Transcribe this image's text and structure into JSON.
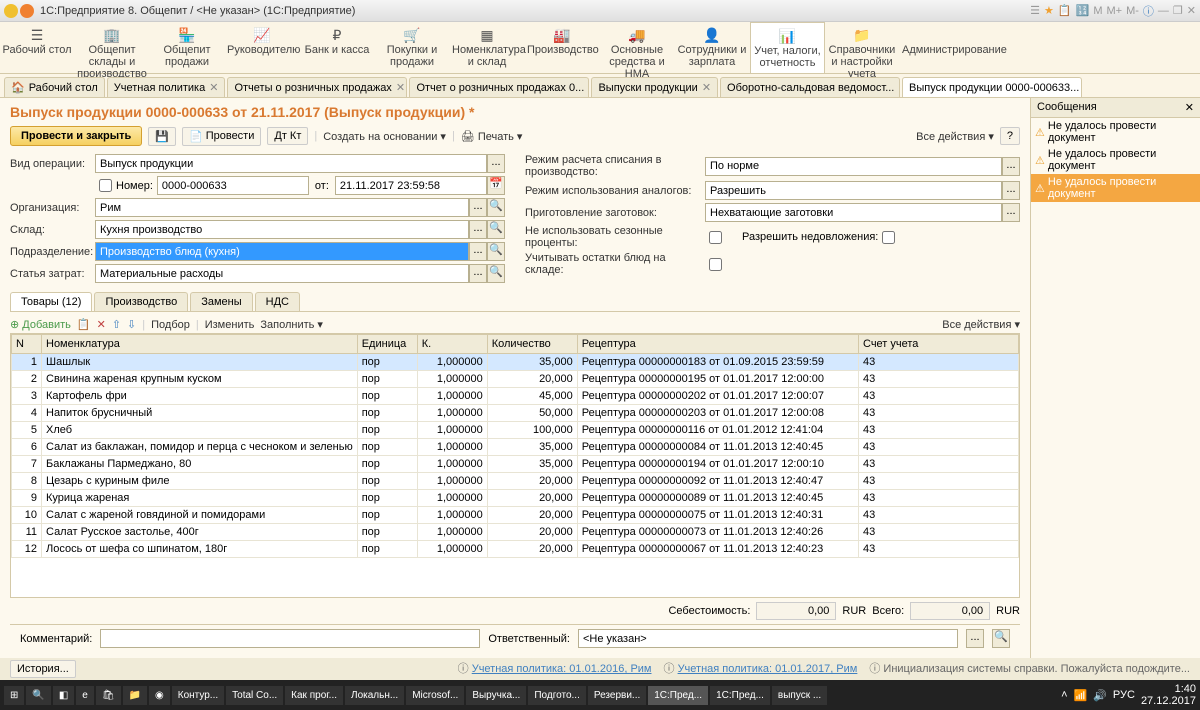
{
  "window_title": "1С:Предприятие 8. Общепит / <Не указан>  (1С:Предприятие)",
  "main_menu": [
    {
      "label": "Рабочий стол"
    },
    {
      "label": "Общепит склады и производство"
    },
    {
      "label": "Общепит продажи"
    },
    {
      "label": "Руководителю"
    },
    {
      "label": "Банк и касса"
    },
    {
      "label": "Покупки и продажи"
    },
    {
      "label": "Номенклатура и склад"
    },
    {
      "label": "Производство"
    },
    {
      "label": "Основные средства и НМА"
    },
    {
      "label": "Сотрудники и зарплата"
    },
    {
      "label": "Учет, налоги, отчетность"
    },
    {
      "label": "Справочники и настройки учета"
    },
    {
      "label": "Администрирование"
    }
  ],
  "tabs": [
    {
      "label": "Рабочий стол"
    },
    {
      "label": "Учетная политика"
    },
    {
      "label": "Отчеты о розничных продажах"
    },
    {
      "label": "Отчет о розничных продажах 0..."
    },
    {
      "label": "Выпуски продукции"
    },
    {
      "label": "Оборотно-сальдовая ведомост..."
    },
    {
      "label": "Выпуск продукции 0000-000633...",
      "active": true
    }
  ],
  "side": {
    "title": "Сообщения",
    "msgs": [
      "Не удалось провести документ",
      "Не удалось провести документ",
      "Не удалось провести документ"
    ]
  },
  "doc_title": "Выпуск продукции 0000-000633 от 21.11.2017 (Выпуск продукции) *",
  "actions": {
    "main": "Провести и закрыть",
    "post": "Провести",
    "create": "Создать на основании",
    "print": "Печать",
    "all": "Все действия"
  },
  "form": {
    "vid_label": "Вид операции:",
    "vid": "Выпуск продукции",
    "num_label": "Номер:",
    "num": "0000-000633",
    "ot": "от:",
    "date": "21.11.2017 23:59:58",
    "org_label": "Организация:",
    "org": "Рим",
    "sklad_label": "Склад:",
    "sklad": "Кухня производство",
    "podr_label": "Подразделение:",
    "podr": "Производство блюд (кухня)",
    "stat_label": "Статья затрат:",
    "stat": "Материальные расходы",
    "rezh1_label": "Режим расчета списания в производство:",
    "rezh1": "По норме",
    "rezh2_label": "Режим использования аналогов:",
    "rezh2": "Разрешить",
    "prig_label": "Приготовление заготовок:",
    "prig": "Нехватающие заготовки",
    "sez_label": "Не использовать сезонные проценты:",
    "nedo_label": "Разрешить недовложения:",
    "ost_label": "Учитывать остатки блюд на складе:"
  },
  "inner_tabs": [
    "Товары (12)",
    "Производство",
    "Замены",
    "НДС"
  ],
  "grid_tb": {
    "add": "Добавить",
    "podbor": "Подбор",
    "izm": "Изменить",
    "fill": "Заполнить",
    "all": "Все действия"
  },
  "cols": {
    "n": "N",
    "nom": "Номенклатура",
    "ed": "Единица",
    "k": "К.",
    "qty": "Количество",
    "rec": "Рецептура",
    "acc": "Счет учета"
  },
  "rows": [
    {
      "n": 1,
      "nom": "Шашлык",
      "ed": "пор",
      "k": "1,000000",
      "qty": "35,000",
      "rec": "Рецептура 00000000183 от 01.09.2015 23:59:59",
      "acc": "43"
    },
    {
      "n": 2,
      "nom": "Свинина жареная крупным куском",
      "ed": "пор",
      "k": "1,000000",
      "qty": "20,000",
      "rec": "Рецептура 00000000195 от 01.01.2017 12:00:00",
      "acc": "43"
    },
    {
      "n": 3,
      "nom": "Картофель фри",
      "ed": "пор",
      "k": "1,000000",
      "qty": "45,000",
      "rec": "Рецептура 00000000202 от 01.01.2017 12:00:07",
      "acc": "43"
    },
    {
      "n": 4,
      "nom": "Напиток брусничный",
      "ed": "пор",
      "k": "1,000000",
      "qty": "50,000",
      "rec": "Рецептура 00000000203 от 01.01.2017 12:00:08",
      "acc": "43"
    },
    {
      "n": 5,
      "nom": "Хлеб",
      "ed": "пор",
      "k": "1,000000",
      "qty": "100,000",
      "rec": "Рецептура 00000000116 от 01.01.2012 12:41:04",
      "acc": "43"
    },
    {
      "n": 6,
      "nom": "Салат из баклажан, помидор и перца с чесноком и зеленью",
      "ed": "пор",
      "k": "1,000000",
      "qty": "35,000",
      "rec": "Рецептура 00000000084 от 11.01.2013 12:40:45",
      "acc": "43"
    },
    {
      "n": 7,
      "nom": "Баклажаны Пармеджано, 80",
      "ed": "пор",
      "k": "1,000000",
      "qty": "35,000",
      "rec": "Рецептура 00000000194 от 01.01.2017 12:00:10",
      "acc": "43"
    },
    {
      "n": 8,
      "nom": "Цезарь с куриным филе",
      "ed": "пор",
      "k": "1,000000",
      "qty": "20,000",
      "rec": "Рецептура 00000000092 от 11.01.2013 12:40:47",
      "acc": "43"
    },
    {
      "n": 9,
      "nom": "Курица жареная",
      "ed": "пор",
      "k": "1,000000",
      "qty": "20,000",
      "rec": "Рецептура 00000000089 от 11.01.2013 12:40:45",
      "acc": "43"
    },
    {
      "n": 10,
      "nom": "Салат с жареной говядиной и помидорами",
      "ed": "пор",
      "k": "1,000000",
      "qty": "20,000",
      "rec": "Рецептура 00000000075 от 11.01.2013 12:40:31",
      "acc": "43"
    },
    {
      "n": 11,
      "nom": "Салат Русское застолье, 400г",
      "ed": "пор",
      "k": "1,000000",
      "qty": "20,000",
      "rec": "Рецептура 00000000073 от 11.01.2013 12:40:26",
      "acc": "43"
    },
    {
      "n": 12,
      "nom": "Лосось от шефа со шпинатом, 180г",
      "ed": "пор",
      "k": "1,000000",
      "qty": "20,000",
      "rec": "Рецептура 00000000067 от 11.01.2013 12:40:23",
      "acc": "43"
    }
  ],
  "footer": {
    "seb": "Себестоимость:",
    "seb_v": "0,00",
    "cur": "RUR",
    "vsego": "Всего:",
    "vsego_v": "0,00"
  },
  "bottom": {
    "komm": "Комментарий:",
    "otv": "Ответственный:",
    "otv_v": "<Не указан>",
    "hist": "История..."
  },
  "status": {
    "p1": "Учетная политика: 01.01.2016, Рим",
    "p2": "Учетная политика: 01.01.2017, Рим",
    "init": "Инициализация системы справки. Пожалуйста подождите..."
  },
  "taskbar": [
    "Контур...",
    "Total Co...",
    "Как прог...",
    "Локальн...",
    "Microsof...",
    "Выручка...",
    "Подгото...",
    "Резерви...",
    "1С:Пред...",
    "1С:Пред...",
    "выпуск ..."
  ],
  "tray": {
    "lang": "РУС",
    "time": "1:40",
    "date": "27.12.2017"
  }
}
